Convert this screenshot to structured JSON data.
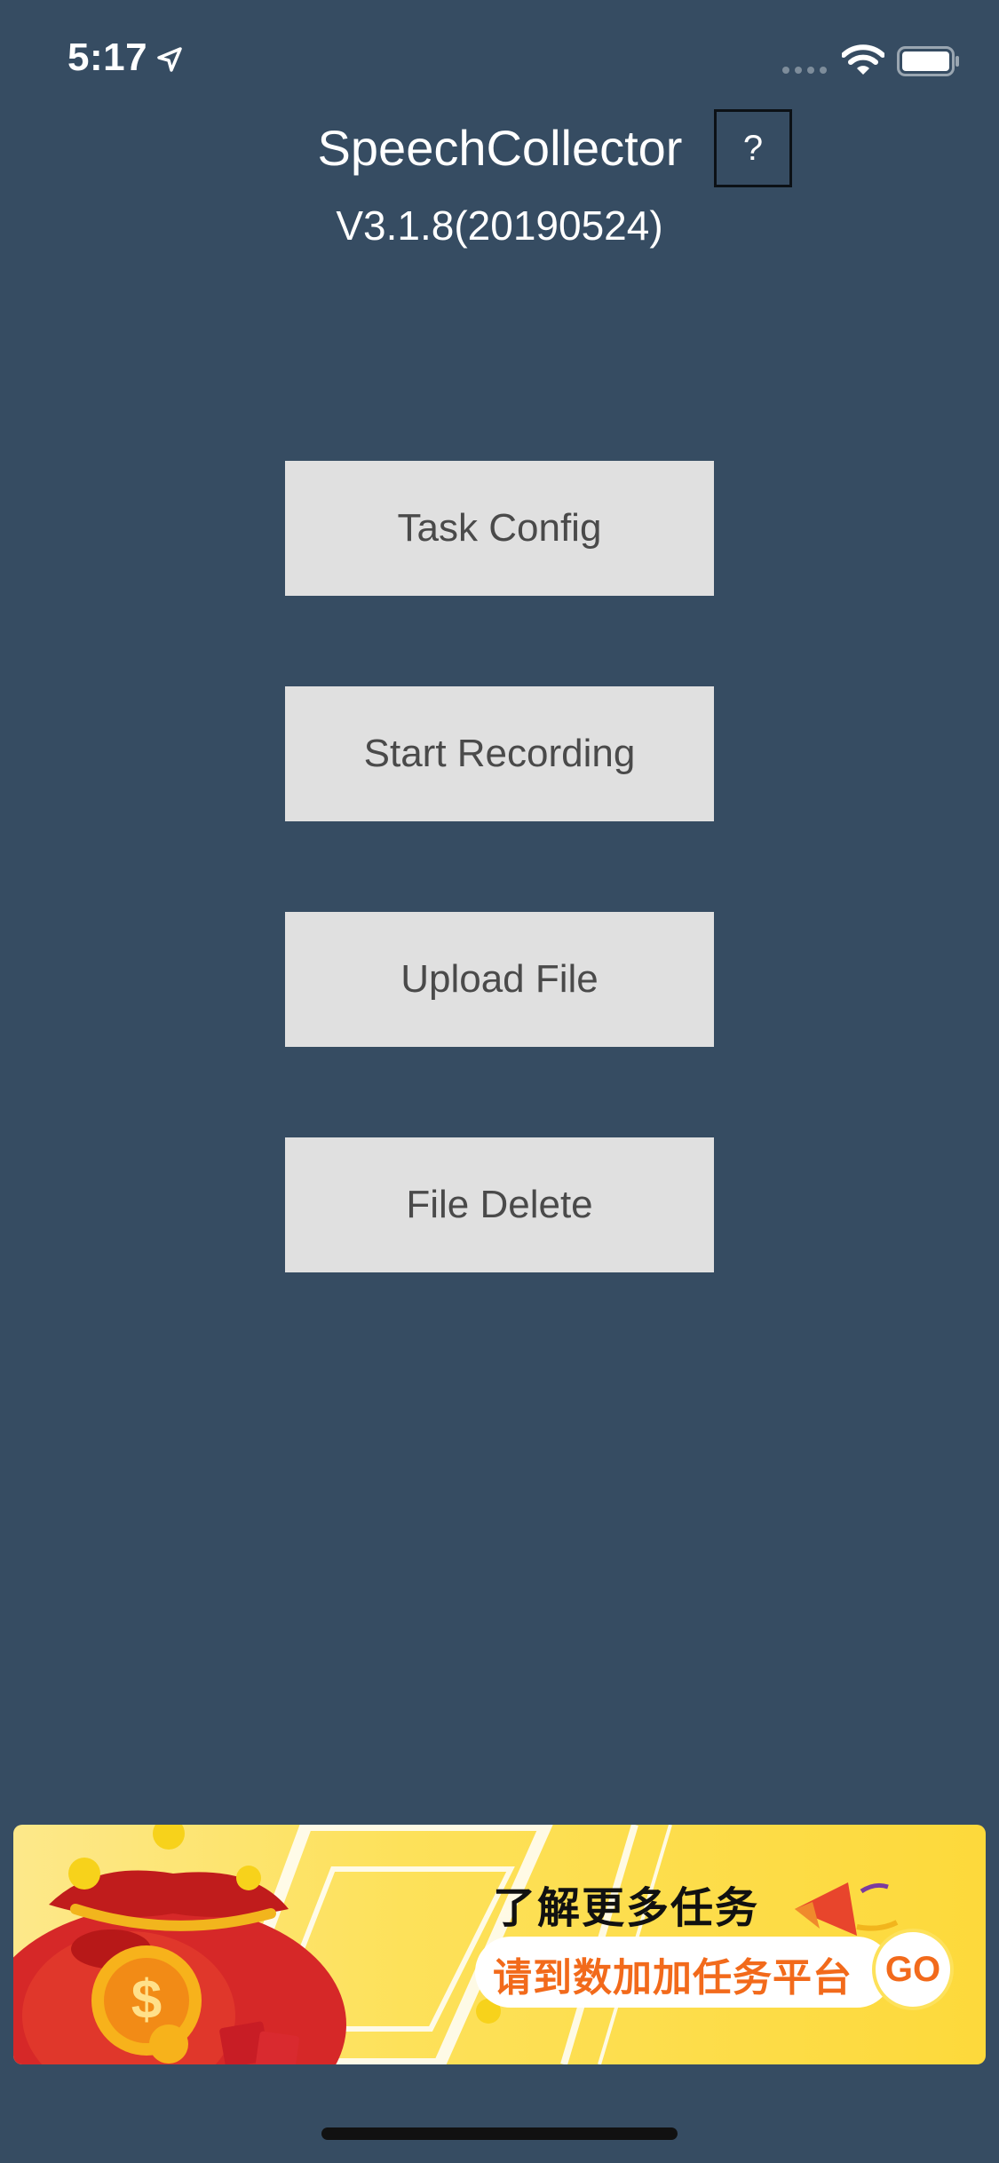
{
  "status_bar": {
    "time": "5:17",
    "icons": [
      "location-arrow-icon",
      "cellular-signal-icon",
      "wifi-icon",
      "battery-icon"
    ]
  },
  "header": {
    "title": "SpeechCollector",
    "help_label": "?",
    "version": "V3.1.8(20190524)"
  },
  "menu": {
    "task_config": "Task Config",
    "start_recording": "Start Recording",
    "upload_file": "Upload File",
    "file_delete": "File Delete"
  },
  "banner": {
    "headline": "了解更多任务",
    "subtitle": "请到数加加任务平台",
    "go_label": "GO",
    "icons": [
      "money-bag-icon",
      "coin-icon",
      "megaphone-icon"
    ]
  },
  "colors": {
    "background": "#364c62",
    "button_bg": "#e0e0e0",
    "button_text": "#4a4a4a",
    "banner_yellow": "#fde15a",
    "banner_accent": "#f26a1b",
    "bag_red": "#d62828"
  }
}
